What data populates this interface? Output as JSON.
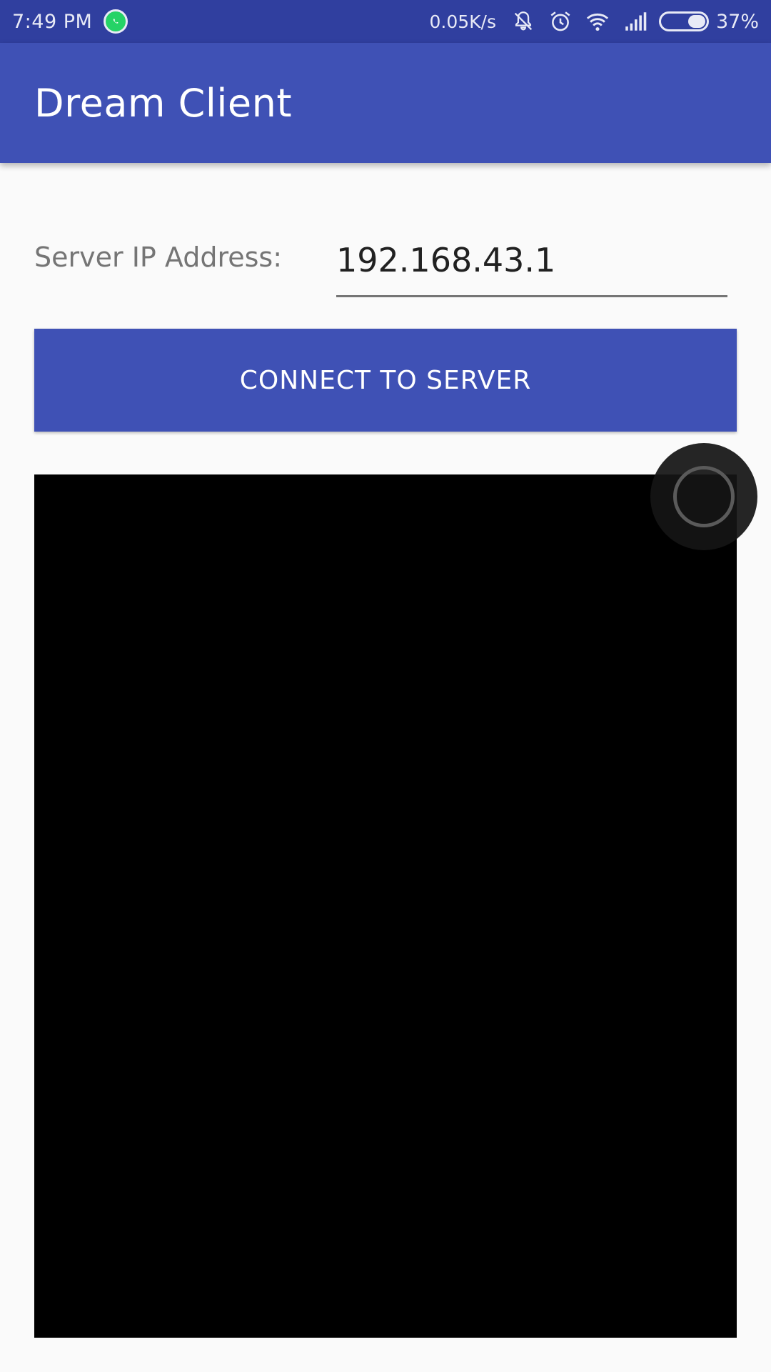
{
  "status_bar": {
    "time": "7:49 PM",
    "network_speed": "0.05K/s",
    "battery_percent": "37%",
    "battery_level": 0.37,
    "icons": [
      "whatsapp-icon",
      "vibrate-off-icon",
      "alarm-icon",
      "wifi-icon",
      "signal-icon",
      "battery-icon"
    ]
  },
  "app_bar": {
    "title": "Dream Client"
  },
  "form": {
    "ip_label": "Server IP Address:",
    "ip_value": "192.168.43.1",
    "connect_label": "CONNECT TO SERVER"
  },
  "colors": {
    "status_bar": "#303f9f",
    "primary": "#3f51b5",
    "display_bg": "#000000"
  }
}
